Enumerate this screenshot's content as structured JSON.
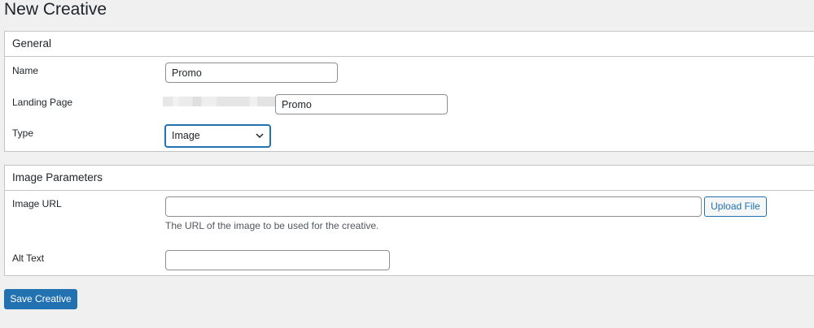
{
  "page": {
    "title": "New Creative"
  },
  "general": {
    "header": "General",
    "name": {
      "label": "Name",
      "value": "Promo"
    },
    "landing_page": {
      "label": "Landing Page",
      "value": "Promo"
    },
    "type": {
      "label": "Type",
      "selected": "Image"
    }
  },
  "image_parameters": {
    "header": "Image Parameters",
    "image_url": {
      "label": "Image URL",
      "value": "",
      "upload_label": "Upload File",
      "description": "The URL of the image to be used for the creative."
    },
    "alt_text": {
      "label": "Alt Text",
      "value": ""
    }
  },
  "actions": {
    "save_label": "Save Creative"
  },
  "colors": {
    "accent": "#2271b1",
    "background": "#f0f0f1",
    "panel_border": "#c3c4c7"
  },
  "icons": {
    "select_chevron": "chevron-down-icon"
  }
}
